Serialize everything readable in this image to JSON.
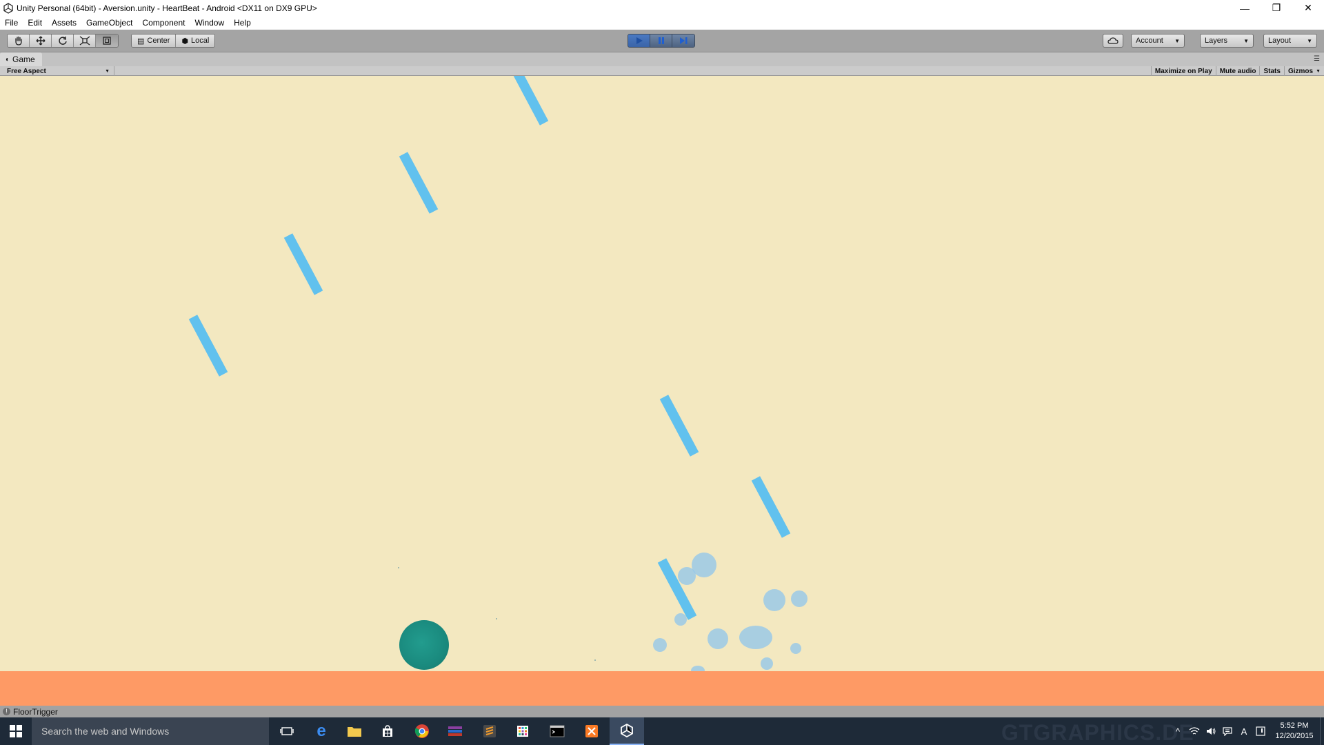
{
  "window": {
    "title": "Unity Personal (64bit) - Aversion.unity - HeartBeat - Android <DX11 on DX9 GPU>",
    "minimize": "—",
    "restore": "❐",
    "close": "✕"
  },
  "menu": [
    "File",
    "Edit",
    "Assets",
    "GameObject",
    "Component",
    "Window",
    "Help"
  ],
  "toolbar": {
    "transform_tools": [
      "hand-icon",
      "move-icon",
      "rotate-icon",
      "scale-icon",
      "rect-icon"
    ],
    "pivot_label": "Center",
    "space_label": "Local",
    "playback": [
      "play-icon",
      "pause-icon",
      "step-icon"
    ],
    "account_label": "Account",
    "layers_label": "Layers",
    "layout_label": "Layout"
  },
  "game_panel": {
    "tab_label": "Game",
    "aspect_label": "Free Aspect",
    "maximize_label": "Maximize on Play",
    "mute_label": "Mute audio",
    "stats_label": "Stats",
    "gizmos_label": "Gizmos"
  },
  "status": {
    "message": "FloorTrigger"
  },
  "taskbar": {
    "search_placeholder": "Search the web and Windows",
    "watermark": "GTGRAPHICS.DE",
    "time": "5:52 PM",
    "date": "12/20/2015",
    "lang": "A"
  },
  "colors": {
    "background": "#f3e8c0",
    "floor": "#fe9a65",
    "bars": "#61c1ee",
    "player": "#1a8a7e",
    "particles": "#8fc6ec"
  }
}
